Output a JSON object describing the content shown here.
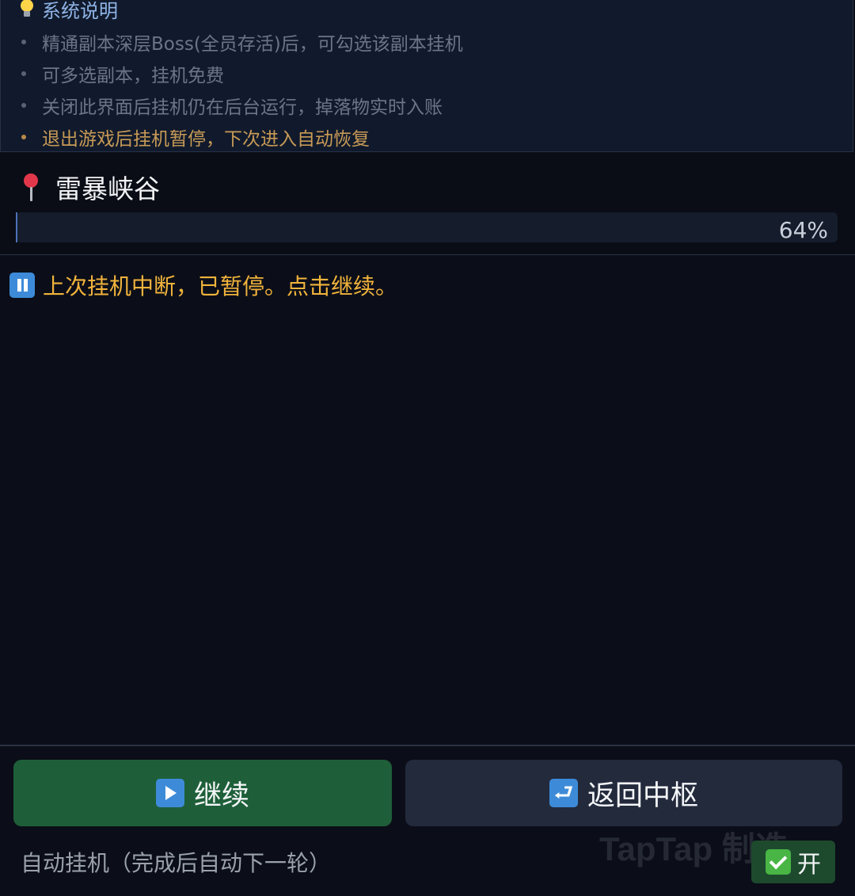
{
  "info": {
    "title": "系统说明",
    "items": [
      "精通副本深层Boss(全员存活)后，可勾选该副本挂机",
      "可多选副本，挂机免费",
      "关闭此界面后挂机仍在后台运行，掉落物实时入账",
      "退出游戏后挂机暂停，下次进入自动恢复"
    ]
  },
  "location": {
    "name": "雷暴峡谷",
    "progress_percent": 64,
    "progress_label": "64%"
  },
  "status": {
    "message": "上次挂机中断，已暂停。点击继续。"
  },
  "buttons": {
    "continue_label": "继续",
    "return_label": "返回中枢"
  },
  "auto": {
    "label": "自动挂机（完成后自动下一轮）",
    "toggle_label": "开"
  },
  "watermark": "TapTap 制造"
}
